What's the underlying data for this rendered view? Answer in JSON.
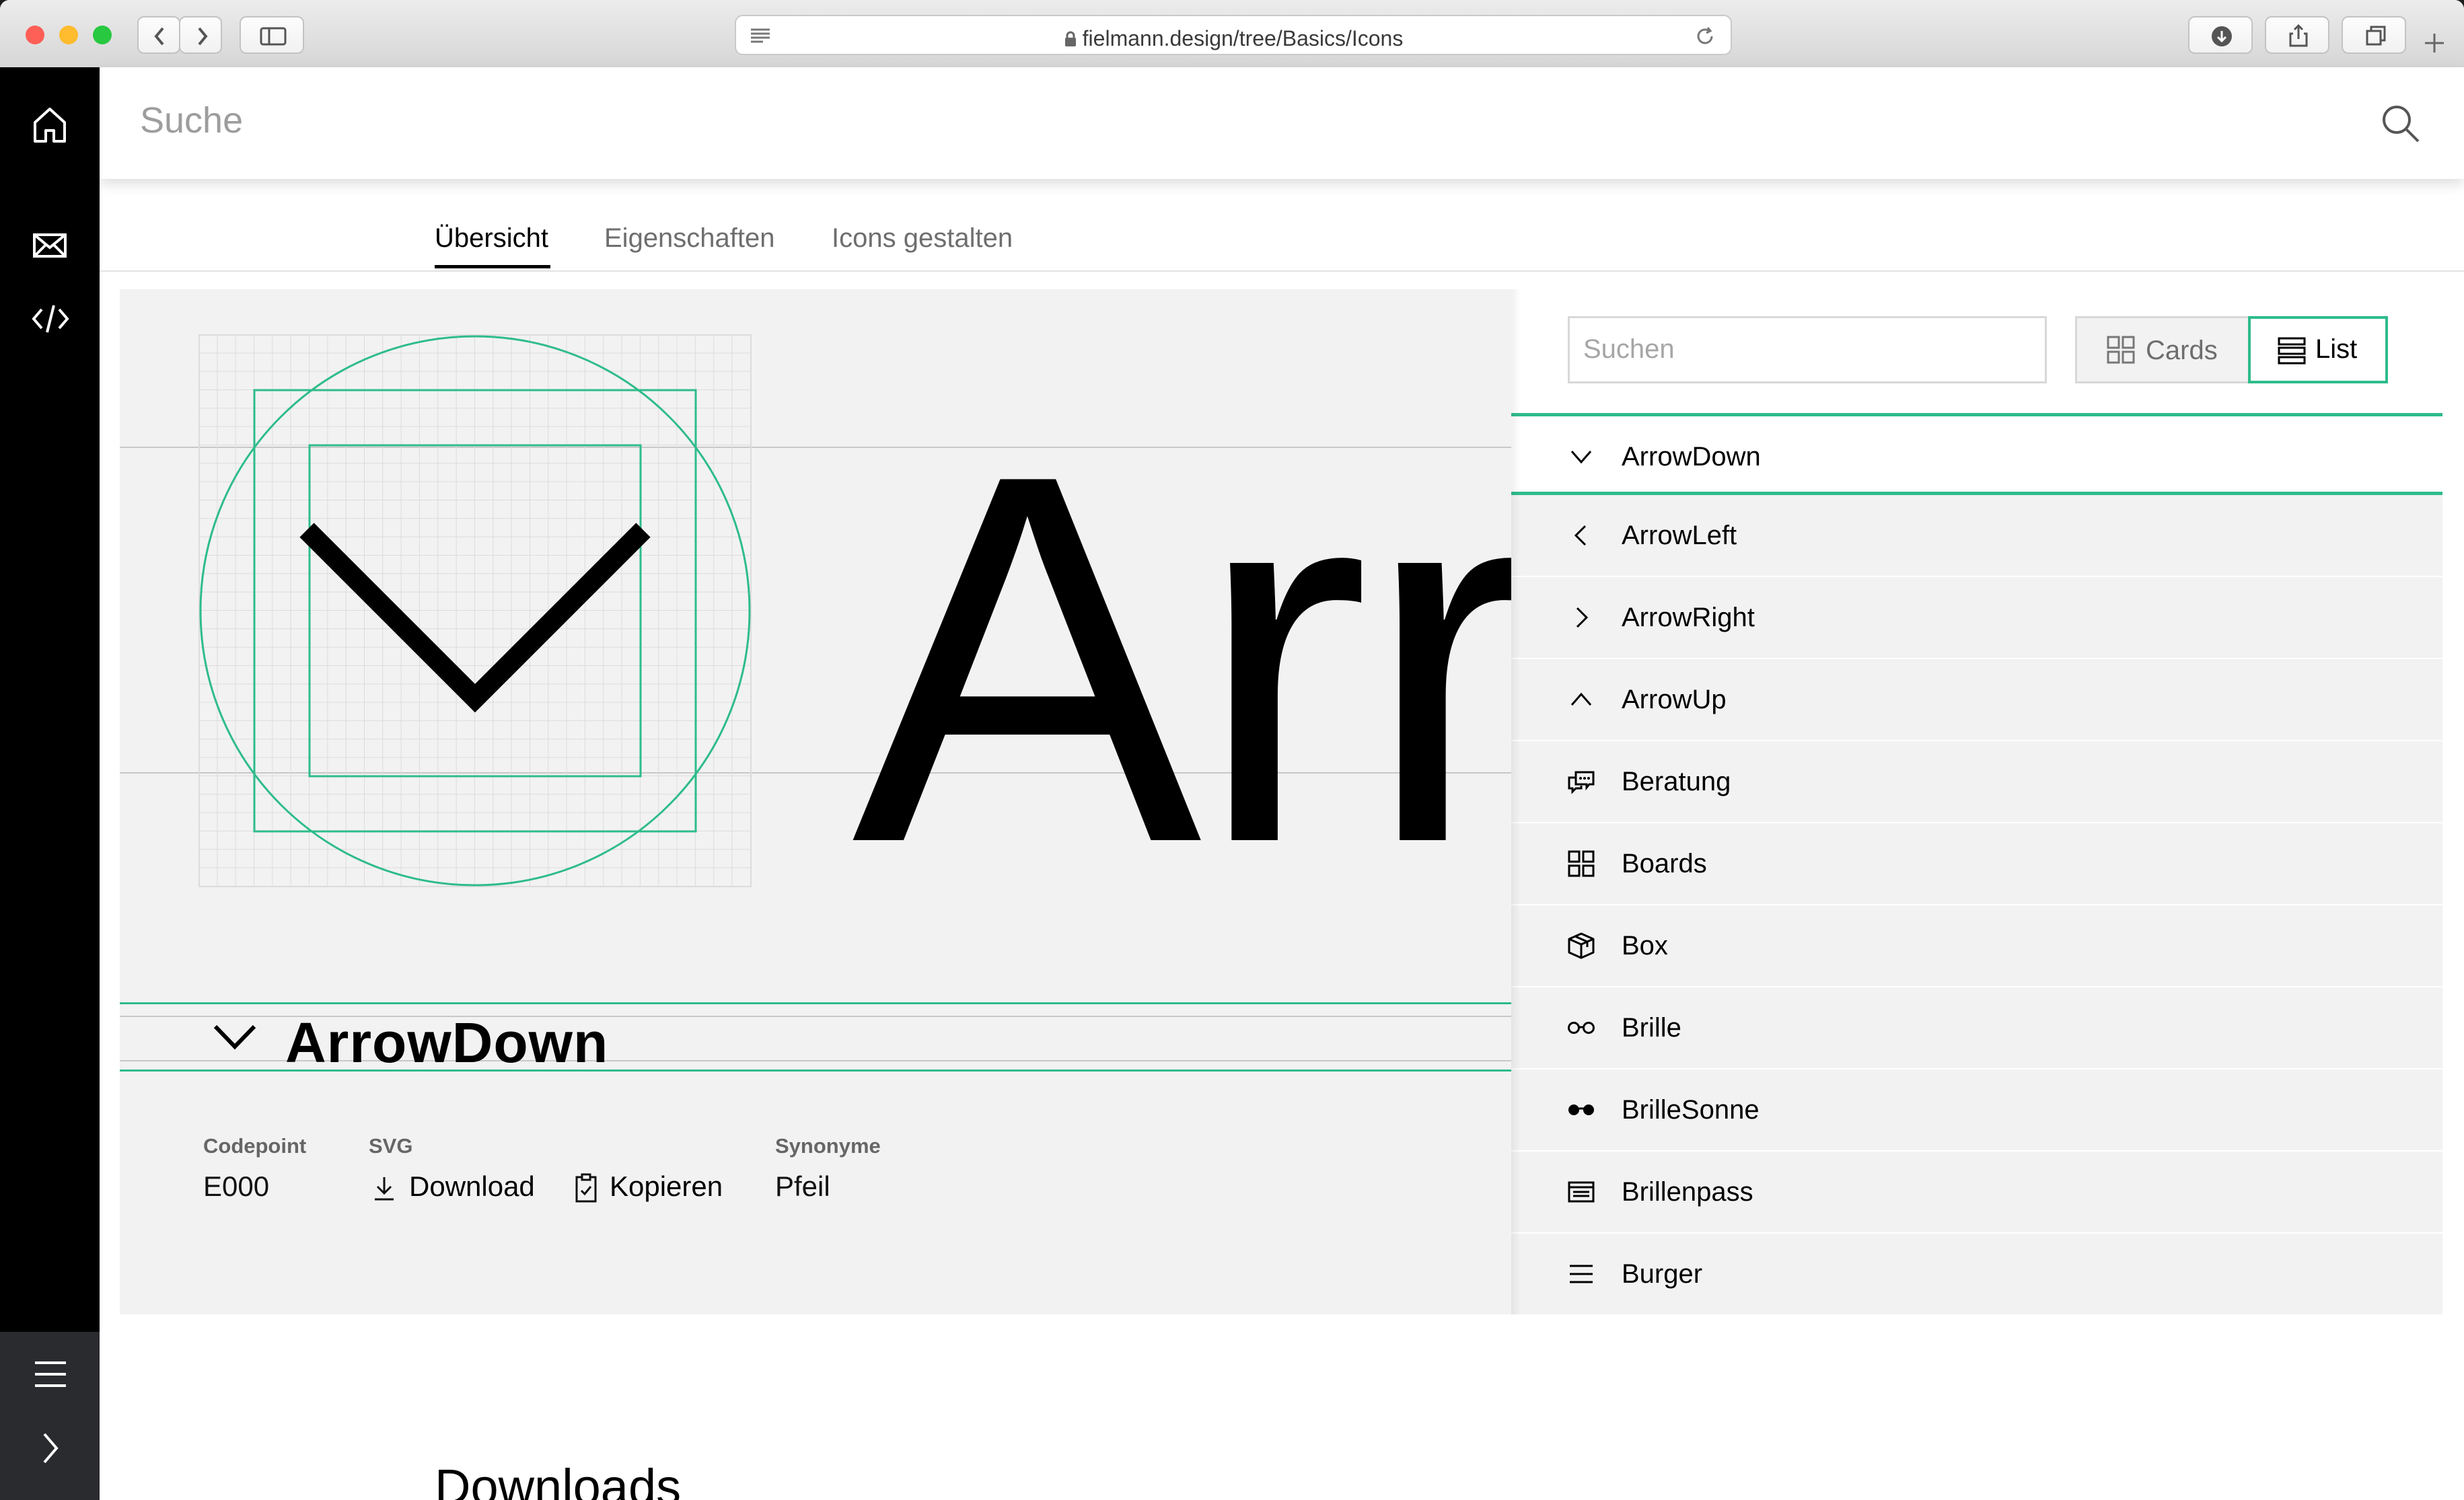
{
  "browser": {
    "url": "fielmann.design/tree/Basics/Icons",
    "traffic_colors": [
      "#fe5f57",
      "#febc2e",
      "#28c840"
    ]
  },
  "header": {
    "search_placeholder": "Suche"
  },
  "tabs": [
    {
      "label": "Übersicht",
      "active": true
    },
    {
      "label": "Eigenschaften",
      "active": false
    },
    {
      "label": "Icons gestalten",
      "active": false
    }
  ],
  "preview": {
    "big_text": "Arrow",
    "icon_name": "ArrowDown",
    "meta": {
      "codepoint_label": "Codepoint",
      "codepoint_value": "E000",
      "svg_label": "SVG",
      "download_label": "Download",
      "copy_label": "Kopieren",
      "synonyms_label": "Synonyme",
      "synonyms_value": "Pfeil"
    },
    "grid_color": "#dcdcdc",
    "guide_color": "#2ebc8a"
  },
  "list_panel": {
    "search_placeholder": "Suchen",
    "view_cards_label": "Cards",
    "view_list_label": "List",
    "active_view": "List",
    "accent_color": "#2ebc8a",
    "items": [
      {
        "label": "ArrowDown",
        "icon": "chevron-down-icon",
        "selected": true
      },
      {
        "label": "ArrowLeft",
        "icon": "chevron-left-icon",
        "selected": false
      },
      {
        "label": "ArrowRight",
        "icon": "chevron-right-icon",
        "selected": false
      },
      {
        "label": "ArrowUp",
        "icon": "chevron-up-icon",
        "selected": false
      },
      {
        "label": "Beratung",
        "icon": "speech-bubbles-icon",
        "selected": false
      },
      {
        "label": "Boards",
        "icon": "grid-icon",
        "selected": false
      },
      {
        "label": "Box",
        "icon": "box-icon",
        "selected": false
      },
      {
        "label": "Brille",
        "icon": "glasses-icon",
        "selected": false
      },
      {
        "label": "BrilleSonne",
        "icon": "sunglasses-icon",
        "selected": false
      },
      {
        "label": "Brillenpass",
        "icon": "id-card-icon",
        "selected": false
      },
      {
        "label": "Burger",
        "icon": "burger-icon",
        "selected": false
      }
    ]
  },
  "sections": {
    "downloads_heading": "Downloads"
  }
}
